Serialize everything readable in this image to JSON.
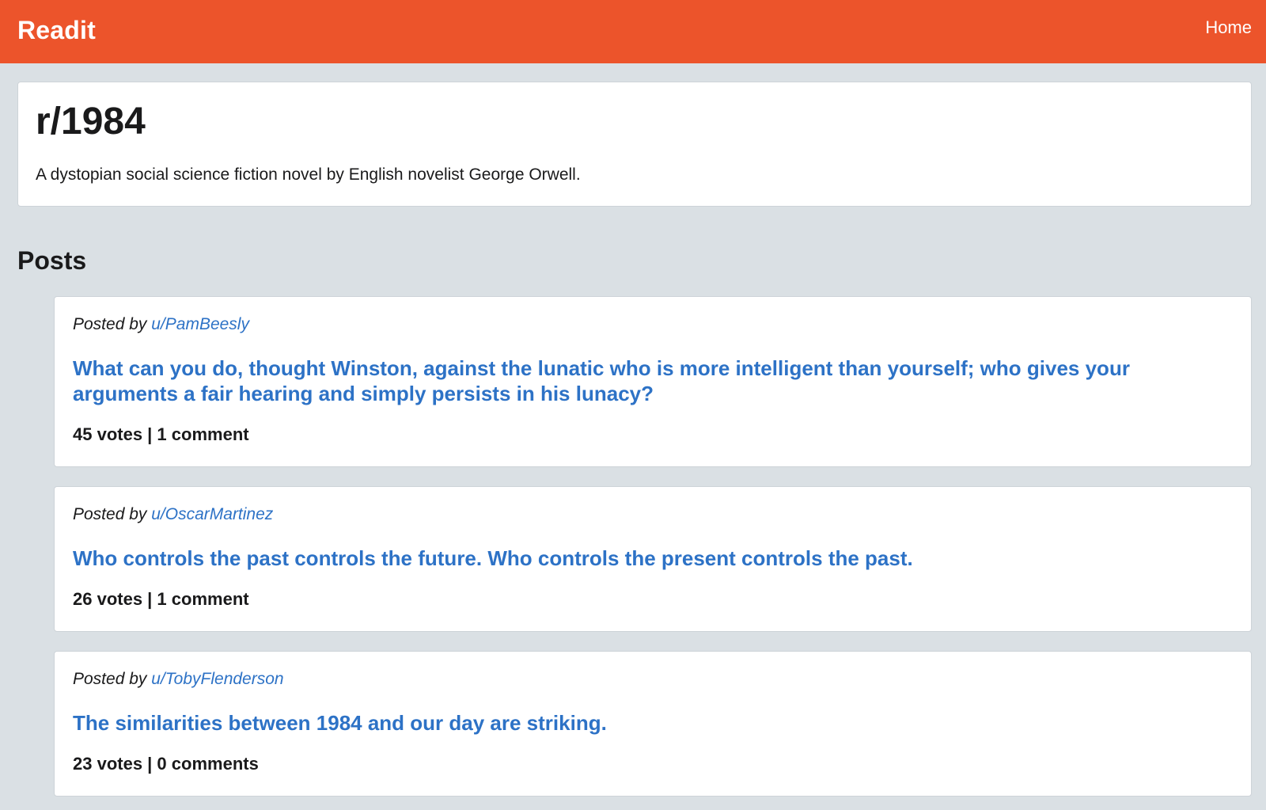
{
  "colors": {
    "navbar": "#ec542b",
    "background": "#dae0e4",
    "link": "#2d72c6",
    "text": "#1a1a1b"
  },
  "navbar": {
    "brand": "Readit",
    "home_link": "Home"
  },
  "subreddit": {
    "title": "r/1984",
    "description": "A dystopian social science fiction novel by English novelist George Orwell."
  },
  "posts_heading": "Posts",
  "posts": [
    {
      "posted_by_prefix": "Posted by",
      "author": "u/PamBeesly",
      "title": "What can you do, thought Winston, against the lunatic who is more intelligent than yourself; who gives your arguments a fair hearing and simply persists in his lunacy?",
      "meta": "45 votes | 1 comment"
    },
    {
      "posted_by_prefix": "Posted by",
      "author": "u/OscarMartinez",
      "title": "Who controls the past controls the future. Who controls the present controls the past.",
      "meta": "26 votes | 1 comment"
    },
    {
      "posted_by_prefix": "Posted by",
      "author": "u/TobyFlenderson",
      "title": "The similarities between 1984 and our day are striking.",
      "meta": "23 votes | 0 comments"
    }
  ]
}
